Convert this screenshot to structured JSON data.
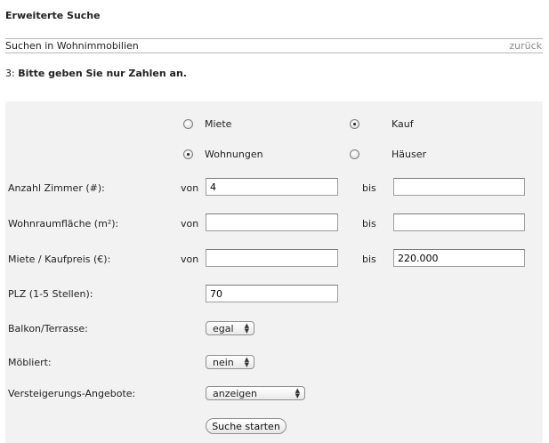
{
  "page": {
    "title": "Erweiterte Suche",
    "subheader": "Suchen in Wohnimmobilien",
    "back_link": "zurück",
    "note_prefix": "3: ",
    "note_bold": "Bitte geben Sie nur Zahlen an."
  },
  "radios": {
    "miete": {
      "label": "Miete",
      "checked": false
    },
    "kauf": {
      "label": "Kauf",
      "checked": true
    },
    "wohnungen": {
      "label": "Wohnungen",
      "checked": true
    },
    "haeuser": {
      "label": "Häuser",
      "checked": false
    }
  },
  "form": {
    "von_label": "von",
    "bis_label": "bis",
    "zimmer": {
      "label": "Anzahl Zimmer (#):",
      "from": "4",
      "to": ""
    },
    "flaeche": {
      "label": "Wohnraumfläche (m²):",
      "from": "",
      "to": ""
    },
    "preis": {
      "label": "Miete / Kaufpreis (€):",
      "from": "",
      "to": "220.000"
    },
    "plz": {
      "label": "PLZ (1-5 Stellen):",
      "value": "70"
    },
    "balkon": {
      "label": "Balkon/Terrasse:",
      "selected": "egal"
    },
    "moebliert": {
      "label": "Möbliert:",
      "selected": "nein"
    },
    "versteigerung": {
      "label": "Versteigerungs-Angebote:",
      "selected": "anzeigen"
    },
    "submit_label": "Suche starten"
  }
}
